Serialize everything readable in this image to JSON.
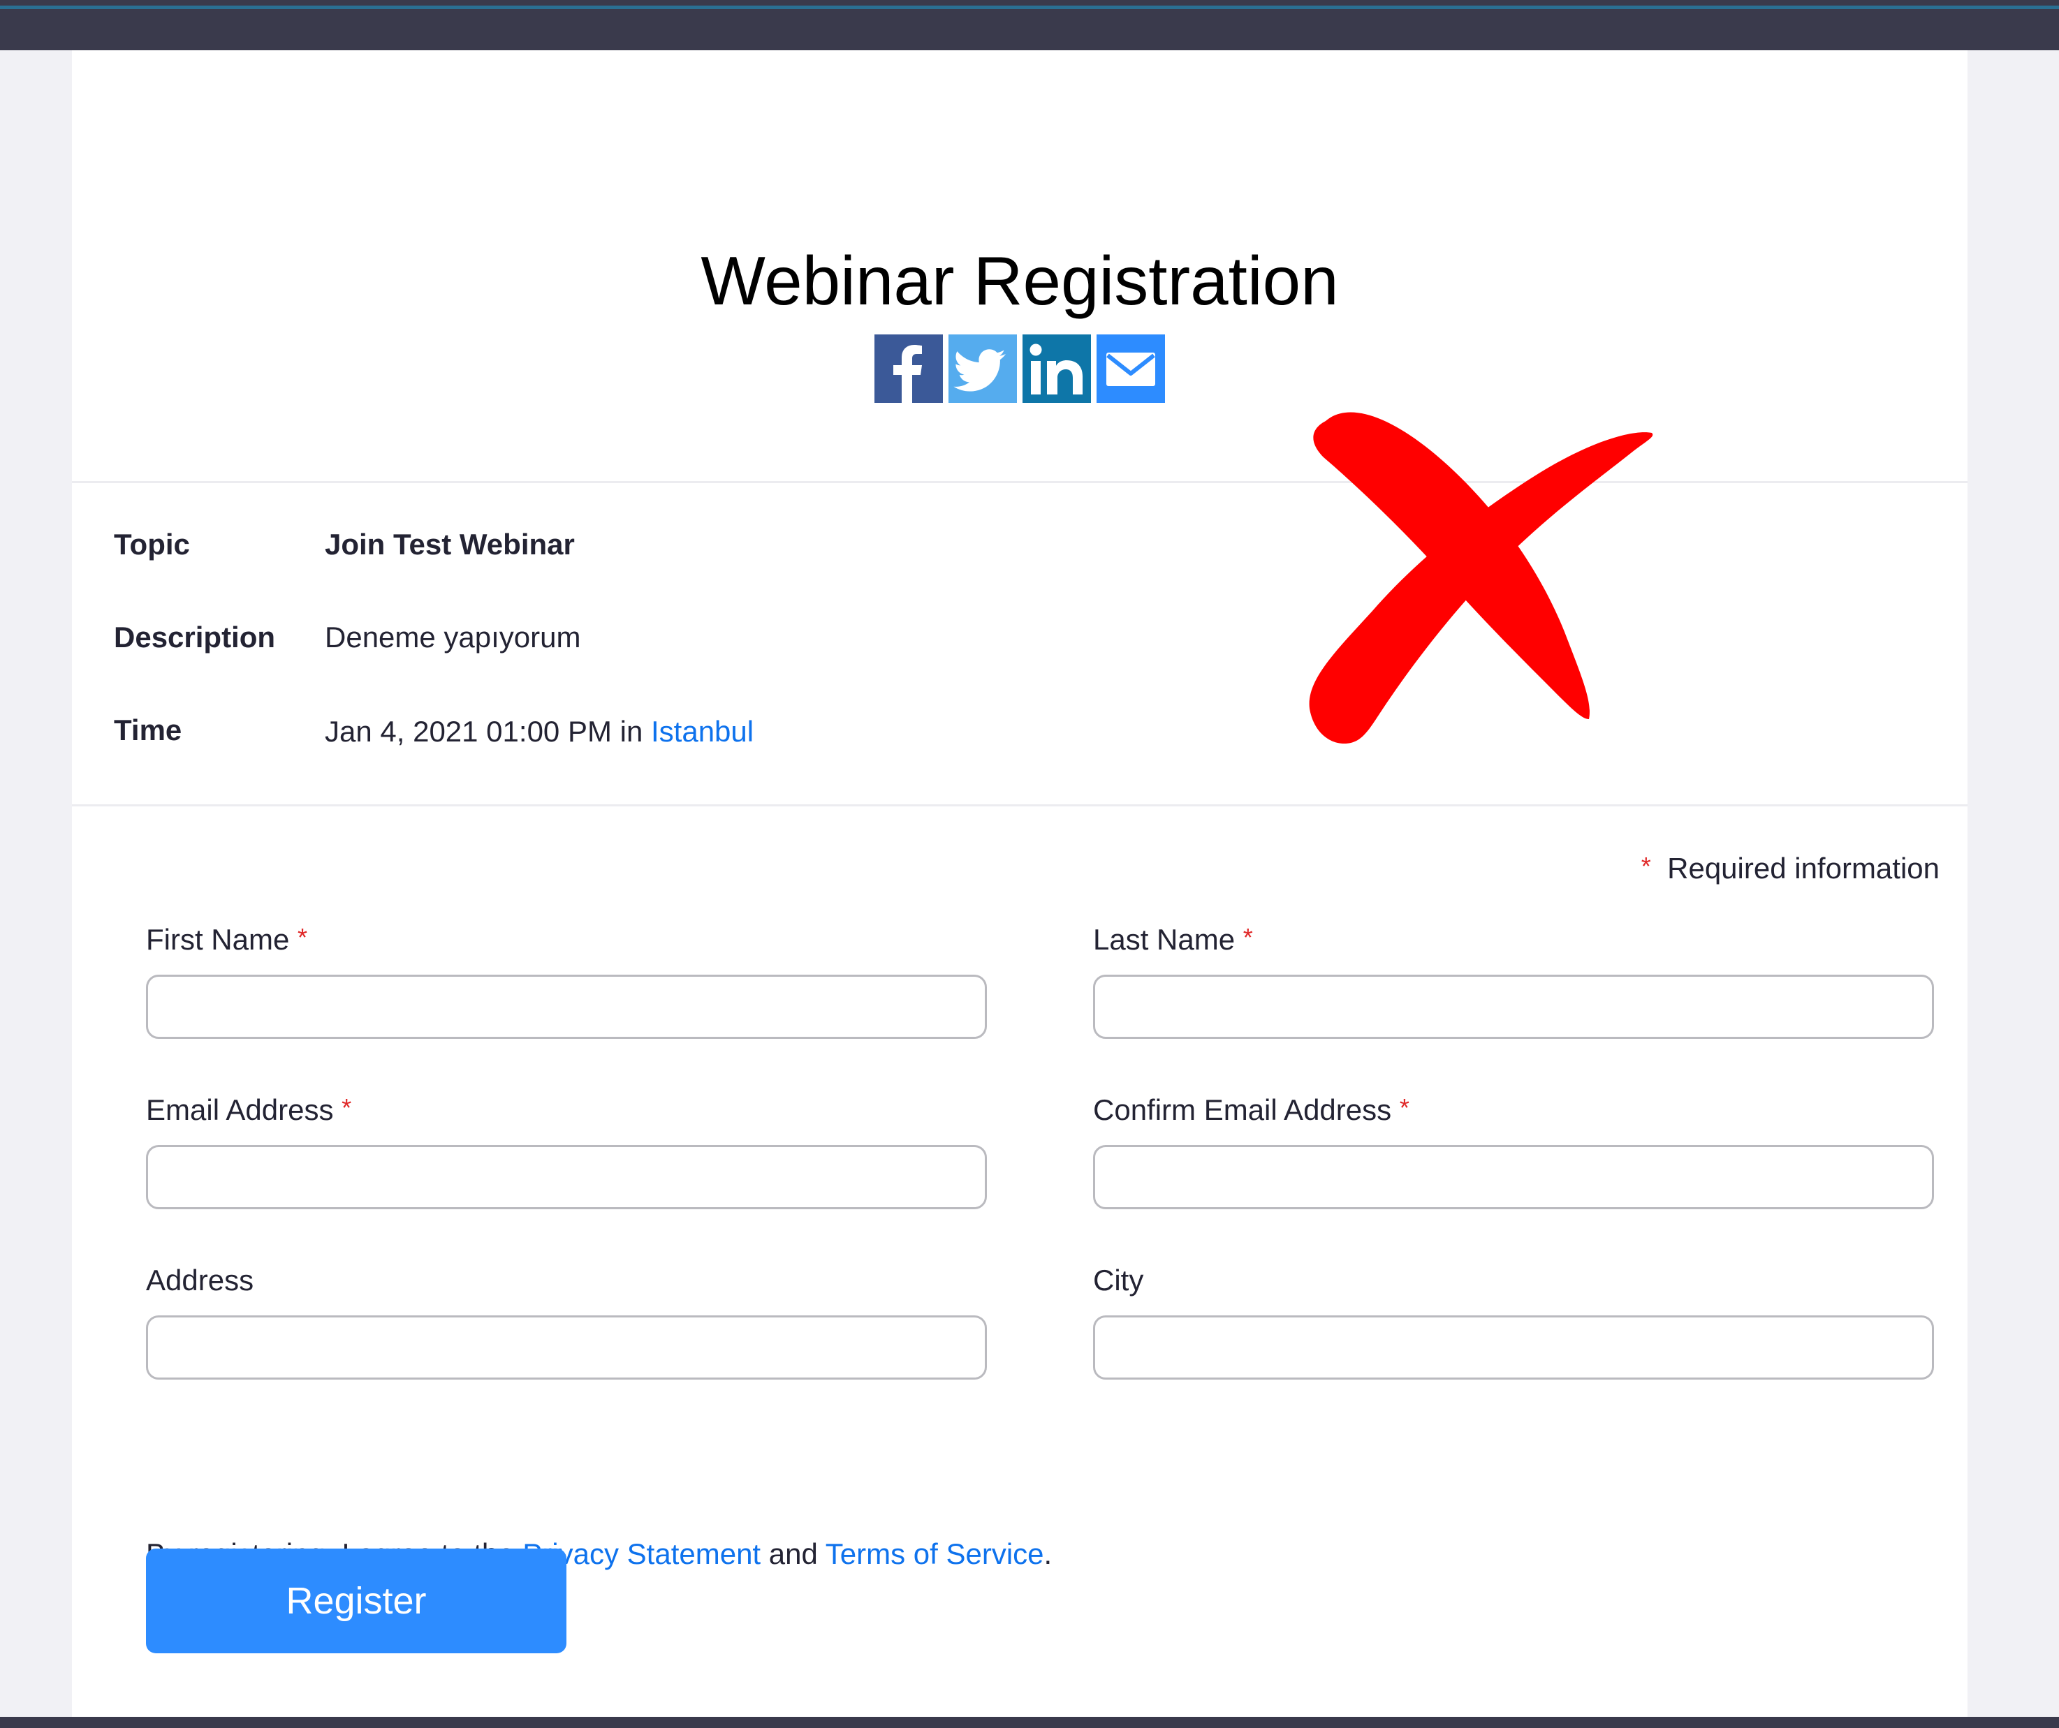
{
  "page": {
    "title": "Webinar Registration"
  },
  "share": {
    "buttons": [
      {
        "icon": "facebook-icon",
        "color": "#3b5998"
      },
      {
        "icon": "twitter-icon",
        "color": "#55acee"
      },
      {
        "icon": "linkedin-icon",
        "color": "#0e76a8"
      },
      {
        "icon": "email-icon",
        "color": "#2d8cff"
      }
    ]
  },
  "info": {
    "topic_label": "Topic",
    "topic_value": "Join Test Webinar",
    "description_label": "Description",
    "description_value": "Deneme yapıyorum",
    "time_label": "Time",
    "time_value": "Jan 4, 2021 01:00 PM in",
    "time_zone_link": "Istanbul"
  },
  "form": {
    "required_star": "*",
    "required_note": "Required information",
    "fields": {
      "first_name": {
        "label": "First Name",
        "value": ""
      },
      "last_name": {
        "label": "Last Name",
        "value": ""
      },
      "email": {
        "label": "Email Address",
        "value": ""
      },
      "confirm_email": {
        "label": "Confirm Email Address",
        "value": ""
      },
      "address": {
        "label": "Address",
        "value": ""
      },
      "city": {
        "label": "City",
        "value": ""
      }
    }
  },
  "legal": {
    "prefix": "By registering, I agree to the",
    "privacy_link": "Privacy Statement",
    "and": "and",
    "terms_link": "Terms of Service",
    "suffix": "."
  },
  "actions": {
    "register_label": "Register"
  },
  "colors": {
    "accent": "#2d8cff",
    "link": "#0e72ed",
    "required": "#e02828",
    "annotation_mark": "#ff0000"
  }
}
